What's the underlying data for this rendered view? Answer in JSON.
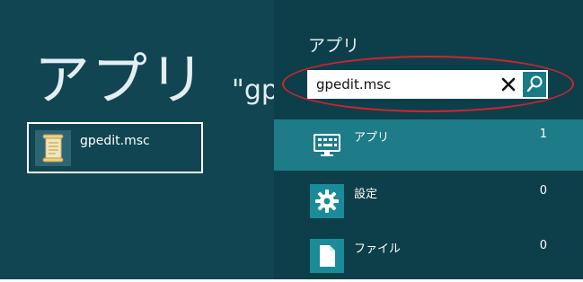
{
  "results": {
    "title": "アプリ",
    "query_display": "\"gpedit.msc\"",
    "items": [
      {
        "name": "gpedit.msc",
        "icon": "scroll-icon"
      }
    ]
  },
  "search_pane": {
    "title": "アプリ",
    "search": {
      "value": "gpedit.msc",
      "clear_icon": "close-icon",
      "search_icon": "magnifier-icon"
    },
    "filters": [
      {
        "label": "アプリ",
        "count": "1",
        "icon": "app-keyboard-icon",
        "active": true
      },
      {
        "label": "設定",
        "count": "0",
        "icon": "gear-icon",
        "active": false
      },
      {
        "label": "ファイル",
        "count": "0",
        "icon": "document-icon",
        "active": false
      }
    ]
  },
  "colors": {
    "left_background": "#114552",
    "right_background": "#0d3f4a",
    "active_row": "#1e7b88",
    "icon_tile": "#1a8b98",
    "annotation": "#d2232f"
  }
}
